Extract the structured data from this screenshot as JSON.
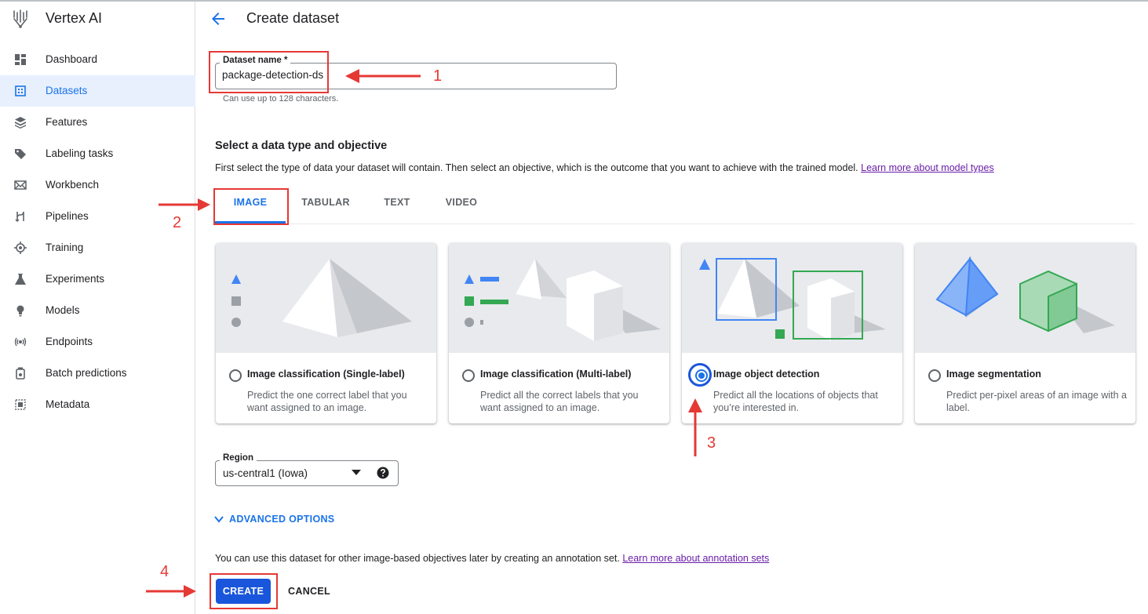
{
  "app": {
    "title": "Vertex AI"
  },
  "sidebar": {
    "items": [
      {
        "label": "Dashboard",
        "icon": "dashboard-icon"
      },
      {
        "label": "Datasets",
        "icon": "datasets-icon",
        "active": true
      },
      {
        "label": "Features",
        "icon": "features-icon"
      },
      {
        "label": "Labeling tasks",
        "icon": "tag-icon"
      },
      {
        "label": "Workbench",
        "icon": "workbench-icon"
      },
      {
        "label": "Pipelines",
        "icon": "pipelines-icon"
      },
      {
        "label": "Training",
        "icon": "training-icon"
      },
      {
        "label": "Experiments",
        "icon": "flask-icon"
      },
      {
        "label": "Models",
        "icon": "lightbulb-icon"
      },
      {
        "label": "Endpoints",
        "icon": "broadcast-icon"
      },
      {
        "label": "Batch predictions",
        "icon": "batch-icon"
      },
      {
        "label": "Metadata",
        "icon": "metadata-icon"
      }
    ]
  },
  "header": {
    "title": "Create dataset",
    "back_icon": "arrow-back-icon"
  },
  "dataset_name": {
    "label": "Dataset name *",
    "value": "package-detection-ds",
    "hint": "Can use up to 128 characters."
  },
  "section": {
    "title": "Select a data type and objective",
    "description": "First select the type of data your dataset will contain. Then select an objective, which is the outcome that you want to achieve with the trained model.",
    "learn_more": "Learn more about model types"
  },
  "tabs": [
    {
      "label": "IMAGE",
      "active": true
    },
    {
      "label": "TABULAR"
    },
    {
      "label": "TEXT"
    },
    {
      "label": "VIDEO"
    }
  ],
  "objectives": [
    {
      "title": "Image classification (Single-label)",
      "description": "Predict the one correct label that you want assigned to an image.",
      "selected": false
    },
    {
      "title": "Image classification (Multi-label)",
      "description": "Predict all the correct labels that you want assigned to an image.",
      "selected": false
    },
    {
      "title": "Image object detection",
      "description": "Predict all the locations of objects that you’re interested in.",
      "selected": true
    },
    {
      "title": "Image segmentation",
      "description": "Predict per-pixel areas of an image with a label.",
      "selected": false
    }
  ],
  "region": {
    "label": "Region",
    "value": "us-central1 (Iowa)",
    "help_icon": "help-circle-icon"
  },
  "advanced": {
    "label": "ADVANCED OPTIONS",
    "icon": "chevron-down-icon"
  },
  "footer": {
    "note": "You can use this dataset for other image-based objectives later by creating an annotation set.",
    "learn_more": "Learn more about annotation sets"
  },
  "buttons": {
    "create": "CREATE",
    "cancel": "CANCEL"
  },
  "annotations": {
    "step1": "1",
    "step2": "2",
    "step3": "3",
    "step4": "4"
  },
  "colors": {
    "accent": "#1a73e8",
    "primary_button": "#1a56db",
    "annotation": "#e53935",
    "link_visited": "#681da8",
    "green_shape": "#34a853",
    "image_bg": "#e8eaed"
  }
}
